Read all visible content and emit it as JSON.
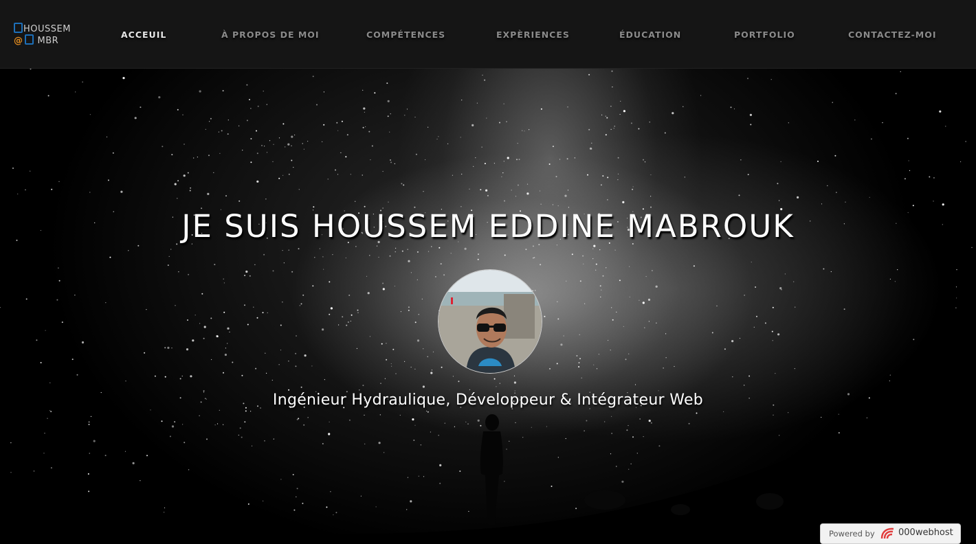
{
  "logo": {
    "line1": "HOUSSEM",
    "line2_at": "@",
    "line2": "MBR"
  },
  "nav": {
    "items": [
      {
        "label": "ACCEUIL",
        "active": true
      },
      {
        "label": "À PROPOS DE MOI",
        "active": false
      },
      {
        "label": "COMPÉTENCES",
        "active": false
      },
      {
        "label": "EXPÈRIENCES",
        "active": false
      },
      {
        "label": "ÉDUCATION",
        "active": false
      },
      {
        "label": "PORTFOLIO",
        "active": false
      },
      {
        "label": "CONTACTEZ-MOI",
        "active": false
      }
    ]
  },
  "hero": {
    "title": "JE SUIS HOUSSEM EDDINE MABROUK",
    "subtitle": "Ingénieur Hydraulique, Développeur & Intégrateur Web",
    "avatar_icon": "profile-photo"
  },
  "badge": {
    "powered_label": "Powered by",
    "brand": "000webhost",
    "brand_icon": "000webhost-logo-icon"
  },
  "colors": {
    "nav_bg": "#151515",
    "nav_active": "#e6e6e6",
    "nav_inactive": "#8a8a8a",
    "logo_blue": "#1d6fb8",
    "logo_orange": "#e08a1e",
    "badge_red": "#e23c3c"
  }
}
